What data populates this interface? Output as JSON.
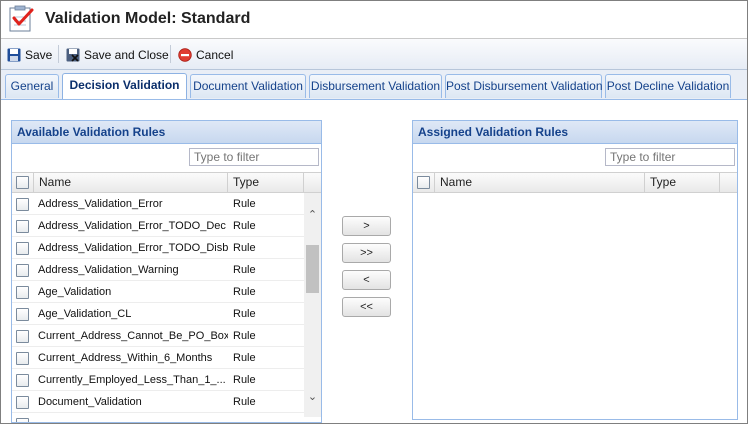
{
  "window": {
    "title": "Validation Model: Standard",
    "icon": "checklist-icon"
  },
  "toolbar": {
    "save_label": "Save",
    "save_close_label": "Save and Close",
    "cancel_label": "Cancel"
  },
  "tabs": [
    {
      "label": "General",
      "active": false
    },
    {
      "label": "Decision Validation",
      "active": true
    },
    {
      "label": "Document Validation",
      "active": false
    },
    {
      "label": "Disbursement Validation",
      "active": false
    },
    {
      "label": "Post Disbursement Validation",
      "active": false
    },
    {
      "label": "Post Decline Validation",
      "active": false
    }
  ],
  "available": {
    "title": "Available Validation Rules",
    "filter_placeholder": "Type to filter",
    "col_name": "Name",
    "col_type": "Type",
    "rows": [
      {
        "name": "Address_Validation_Error",
        "type": "Rule"
      },
      {
        "name": "Address_Validation_Error_TODO_Dec",
        "type": "Rule"
      },
      {
        "name": "Address_Validation_Error_TODO_Disb",
        "type": "Rule"
      },
      {
        "name": "Address_Validation_Warning",
        "type": "Rule"
      },
      {
        "name": "Age_Validation",
        "type": "Rule"
      },
      {
        "name": "Age_Validation_CL",
        "type": "Rule"
      },
      {
        "name": "Current_Address_Cannot_Be_PO_Box",
        "type": "Rule"
      },
      {
        "name": "Current_Address_Within_6_Months",
        "type": "Rule"
      },
      {
        "name": "Currently_Employed_Less_Than_1_...",
        "type": "Rule"
      },
      {
        "name": "Document_Validation",
        "type": "Rule"
      }
    ]
  },
  "move_buttons": {
    "add": ">",
    "add_all": ">>",
    "remove": "<",
    "remove_all": "<<"
  },
  "assigned": {
    "title": "Assigned Validation Rules",
    "filter_placeholder": "Type to filter",
    "col_name": "Name",
    "col_type": "Type",
    "rows": []
  },
  "colors": {
    "panel_header": "#15428b",
    "border": "#99bbe8",
    "cancel_icon": "#e03c31",
    "save_icon": "#1f4e9a"
  }
}
